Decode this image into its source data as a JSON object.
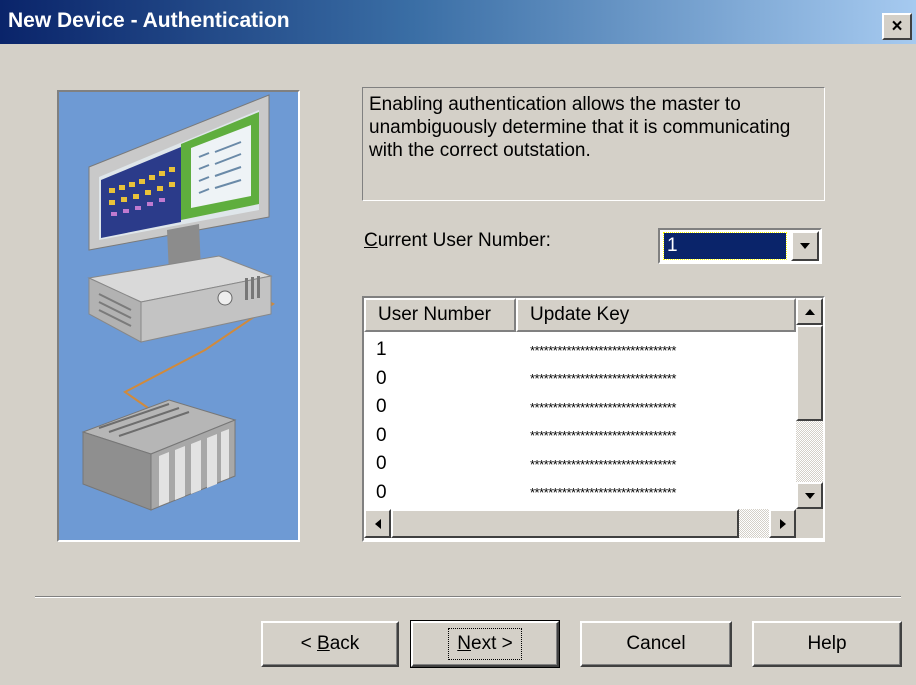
{
  "window": {
    "title": "New Device - Authentication",
    "close_label": "×"
  },
  "description": "Enabling authentication allows the master to unambiguously determine that it is communicating with the correct outstation.",
  "current_user": {
    "label_mnemonic": "C",
    "label_rest": "urrent User Number:",
    "value": "1"
  },
  "users_table": {
    "columns": [
      "User Number",
      "Update Key"
    ],
    "rows": [
      {
        "user_number": "1",
        "update_key": "********************************"
      },
      {
        "user_number": "0",
        "update_key": "********************************"
      },
      {
        "user_number": "0",
        "update_key": "********************************"
      },
      {
        "user_number": "0",
        "update_key": "********************************"
      },
      {
        "user_number": "0",
        "update_key": "********************************"
      },
      {
        "user_number": "0",
        "update_key": "********************************"
      }
    ]
  },
  "buttons": {
    "back_prefix": "< ",
    "back_mnemonic": "B",
    "back_rest": "ack",
    "next_mnemonic": "N",
    "next_rest": "ext >",
    "cancel": "Cancel",
    "help": "Help"
  },
  "icons": [
    "close-icon",
    "dropdown-arrow-icon",
    "scroll-up-arrow-icon",
    "scroll-down-arrow-icon",
    "scroll-left-arrow-icon",
    "scroll-right-arrow-icon"
  ],
  "colors": {
    "titlebar_start": "#0a246a",
    "titlebar_end": "#a6caf0",
    "dialog_bg": "#d4d0c8",
    "illustration_bg": "#6e9ad4",
    "selection": "#0a246a"
  }
}
